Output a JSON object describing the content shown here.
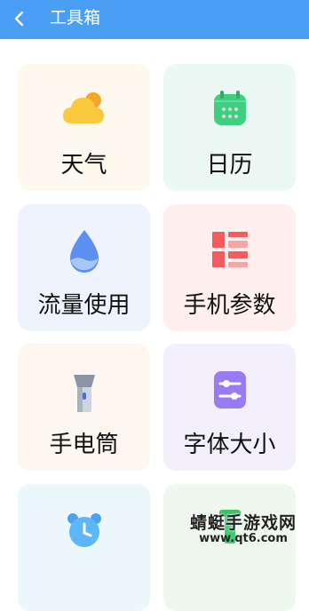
{
  "header": {
    "back_icon": "chevron-left-icon",
    "title": "工具箱",
    "background": "#4a9ff5"
  },
  "tools": [
    {
      "label": "天气",
      "icon": "weather-cloud-sun-icon"
    },
    {
      "label": "日历",
      "icon": "calendar-icon"
    },
    {
      "label": "流量使用",
      "icon": "water-drop-icon"
    },
    {
      "label": "手机参数",
      "icon": "grid-blocks-icon"
    },
    {
      "label": "手电筒",
      "icon": "flashlight-icon"
    },
    {
      "label": "字体大小",
      "icon": "sliders-icon"
    },
    {
      "label": "",
      "icon": "alarm-clock-icon"
    },
    {
      "label": "",
      "icon": "green-tool-icon"
    }
  ],
  "watermark": {
    "text": "蜻蜓手游戏网",
    "url": "www.qt6.com"
  }
}
